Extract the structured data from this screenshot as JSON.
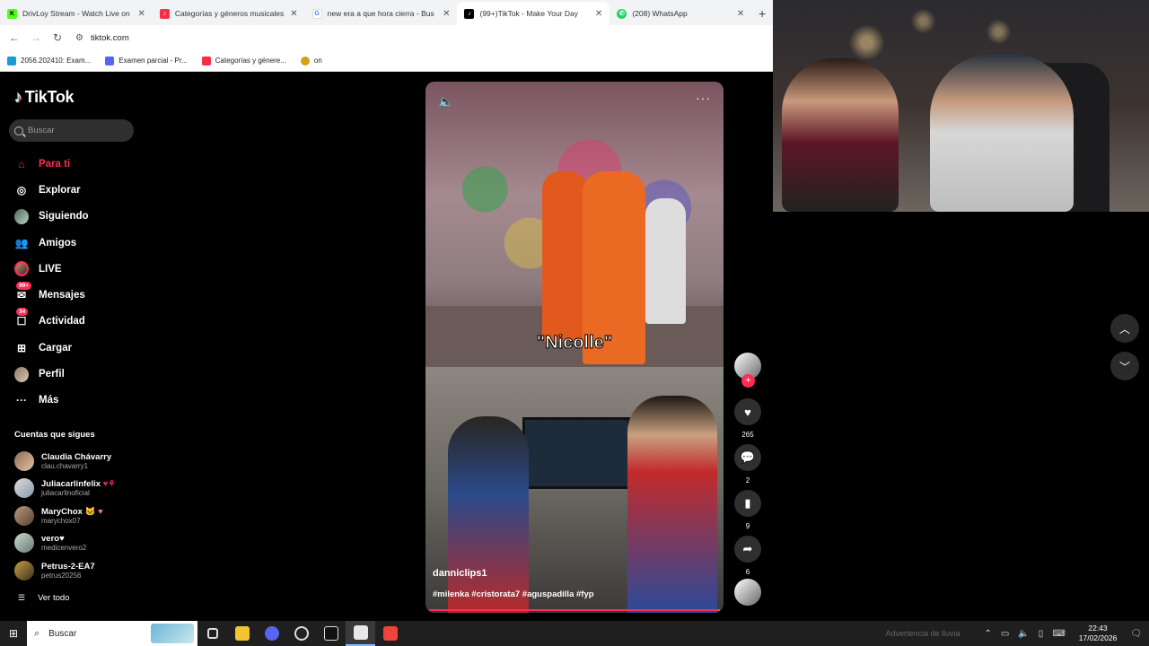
{
  "browser": {
    "tabs": [
      {
        "label": "DrivLoy Stream - Watch Live on",
        "color": "#53fc18",
        "glyph": "K",
        "active": false
      },
      {
        "label": "Categorías y géneros musicales",
        "color": "#fa2d48",
        "glyph": "♪",
        "active": false
      },
      {
        "label": "new era a que hora cierra - Bus",
        "color": "#4285f4",
        "glyph": "G",
        "active": false
      },
      {
        "label": "(99+)TikTok - Make Your Day",
        "color": "#000000",
        "glyph": "♪",
        "active": true
      },
      {
        "label": "(208) WhatsApp",
        "color": "#25d366",
        "glyph": "✆",
        "active": false
      }
    ],
    "url": "tiktok.com",
    "bookmarks": [
      {
        "label": "2056.202410: Exam...",
        "color": "#1a9bd7"
      },
      {
        "label": "Examen parcial - Pr...",
        "color": "#5865f2"
      },
      {
        "label": "Categorías y génere...",
        "color": "#fa2d48"
      },
      {
        "label": "on",
        "color": "#d4a017"
      }
    ]
  },
  "tiktok": {
    "logo": "TikTok",
    "search_placeholder": "Buscar",
    "menu": [
      {
        "label": "Para ti",
        "icon": "home-icon",
        "active": true
      },
      {
        "label": "Explorar",
        "icon": "compass-icon"
      },
      {
        "label": "Siguiendo",
        "icon": "following-avatar-icon"
      },
      {
        "label": "Amigos",
        "icon": "friends-icon"
      },
      {
        "label": "LIVE",
        "icon": "live-icon"
      },
      {
        "label": "Mensajes",
        "icon": "messages-icon",
        "badge": "99+"
      },
      {
        "label": "Actividad",
        "icon": "activity-icon",
        "badge": "34"
      },
      {
        "label": "Cargar",
        "icon": "upload-icon"
      },
      {
        "label": "Perfil",
        "icon": "profile-avatar-icon"
      },
      {
        "label": "Más",
        "icon": "more-icon"
      }
    ],
    "following_title": "Cuentas que sigues",
    "accounts": [
      {
        "name": "Claudia Chávarry",
        "handle": "clau.chavarry1"
      },
      {
        "name": "Juliacarlinfelix",
        "handle": "juliacarlinoficial"
      },
      {
        "name": "MaryChox",
        "handle": "marychox07"
      },
      {
        "name": "vero",
        "handle": "medicenvero2"
      },
      {
        "name": "Petrus-2-EA7",
        "handle": "petrus20256"
      }
    ],
    "see_all": "Ver todo"
  },
  "video": {
    "caption_overlay": "\"Nicolle\"",
    "author": "danniclips1",
    "tags": "#milenka #cristorata7 #aguspadilla #fyp",
    "progress": 0.99,
    "likes": "265",
    "comments": "2",
    "saves": "9",
    "shares": "6"
  },
  "taskbar": {
    "search_placeholder": "Buscar",
    "warning": "Advertencia de lluvia",
    "time": "22:43",
    "date": "17/02/2026"
  },
  "colors": {
    "tiktok_red": "#fe2c55",
    "background": "#000000"
  }
}
